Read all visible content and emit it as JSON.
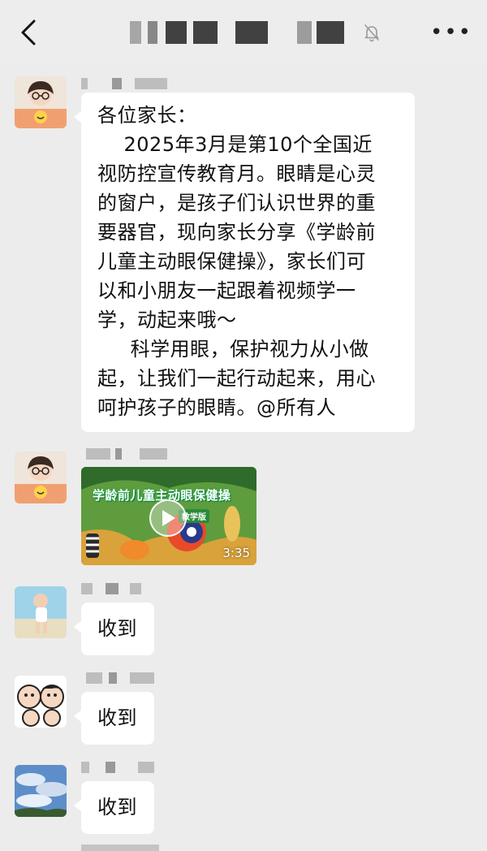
{
  "header": {
    "back_icon": "chevron-left-icon",
    "title_redacted": true,
    "mute_icon": "bell-off-icon",
    "more_icon": "ellipsis-icon",
    "more_label": "•••"
  },
  "messages": [
    {
      "type": "text",
      "avatar": "avatar-child-with-glasses",
      "sender_redacted": true,
      "text": "各位家长：\n    2025年3月是第10个全国近\n视防控宣传教育月。眼睛是心灵\n的窗户，是孩子们认识世界的重\n要器官，现向家长分享《学龄前\n儿童主动眼保健操》，家长们可\n以和小朋友一起跟着视频学一\n学，动起来哦～\n     科学用眼，保护视力从小做\n起，让我们一起行动起来，用心\n呵护孩子的眼睛。@所有人"
    },
    {
      "type": "video",
      "avatar": "avatar-child-with-glasses",
      "sender_redacted": true,
      "video_title": "学龄前儿童主动眼保健操",
      "video_subtitle": "教学版",
      "duration": "3:35"
    },
    {
      "type": "text",
      "avatar": "avatar-boy-beach",
      "sender_redacted": true,
      "text": "收到"
    },
    {
      "type": "text",
      "avatar": "avatar-cartoon-kids",
      "sender_redacted": true,
      "text": "收到"
    },
    {
      "type": "text",
      "avatar": "avatar-blue-sky",
      "sender_redacted": true,
      "text": "收到"
    }
  ],
  "colors": {
    "background": "#ececec",
    "bubble": "#ffffff",
    "text": "#111111"
  }
}
